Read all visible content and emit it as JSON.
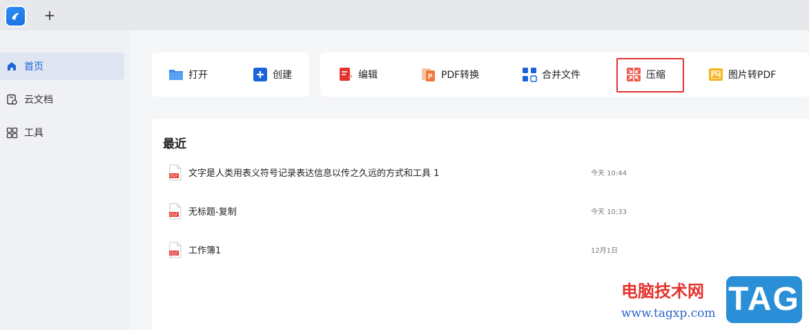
{
  "tabbar": {
    "new_tab_symbol": "+",
    "logo_icon": "app-logo-icon"
  },
  "sidebar": {
    "items": [
      {
        "label": "首页",
        "icon": "home-icon",
        "active": true
      },
      {
        "label": "云文档",
        "icon": "cloud-doc-icon",
        "active": false
      },
      {
        "label": "工具",
        "icon": "grid-apps-icon",
        "active": false
      }
    ]
  },
  "quick_actions": {
    "open": {
      "label": "打开",
      "icon": "folder-icon"
    },
    "create": {
      "label": "创建",
      "icon": "plus-square-icon"
    }
  },
  "toolbar": {
    "edit": {
      "label": "编辑",
      "icon": "edit-doc-icon"
    },
    "pdf_convert": {
      "label": "PDF转换",
      "icon": "pdf-convert-icon"
    },
    "merge": {
      "label": "合并文件",
      "icon": "merge-icon"
    },
    "compress": {
      "label": "压缩",
      "icon": "compress-icon"
    },
    "image_to_pdf": {
      "label": "图片转PDF",
      "icon": "image-icon"
    }
  },
  "recent": {
    "title": "最近",
    "files": [
      {
        "name": "文字是人类用表义符号记录表达信息以传之久远的方式和工具 1",
        "time": "今天 10:44",
        "type": "PDF"
      },
      {
        "name": "无标题-复制",
        "time": "今天 10:33",
        "type": "PDF"
      },
      {
        "name": "工作簿1",
        "time": "12月1日",
        "type": "PDF"
      }
    ]
  },
  "watermark": {
    "site_name": "电脑技术网",
    "url": "www.tagxp.com",
    "badge": "TAG"
  },
  "colors": {
    "accent": "#1a64d8",
    "highlight_border": "#e13030",
    "pdf_red": "#e5322d"
  }
}
